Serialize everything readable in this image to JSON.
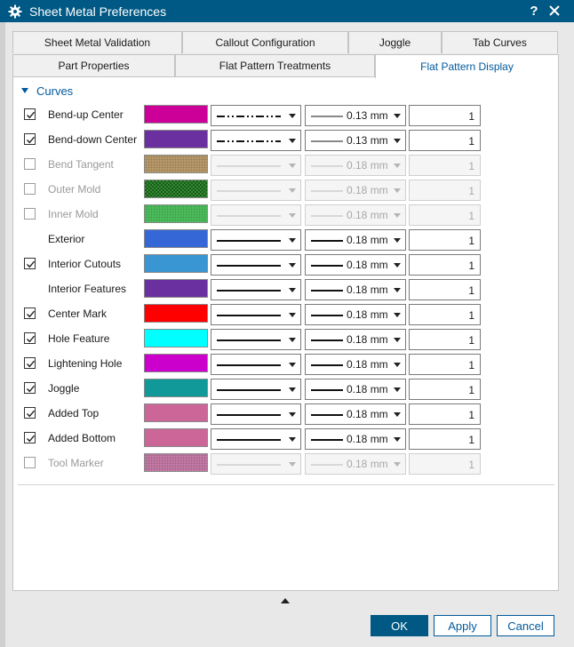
{
  "window": {
    "title": "Sheet Metal Preferences",
    "help_label": "?",
    "accent": "#005984"
  },
  "tabs_top": [
    {
      "label": "Sheet Metal Validation"
    },
    {
      "label": "Callout Configuration"
    },
    {
      "label": "Joggle"
    },
    {
      "label": "Tab Curves"
    }
  ],
  "tabs_bottom": [
    {
      "label": "Part Properties"
    },
    {
      "label": "Flat Pattern Treatments"
    },
    {
      "label": "Flat Pattern Display",
      "active": true
    }
  ],
  "group": {
    "label": "Curves"
  },
  "rows": [
    {
      "label": "Bend-up Center",
      "checkbox": true,
      "checked": true,
      "enabled": true,
      "color": "#cc0099",
      "pattern": "none",
      "line_type": "dash-dot-dot",
      "width": "0.13 mm",
      "weight": "thin",
      "value": "1"
    },
    {
      "label": "Bend-down Center",
      "checkbox": true,
      "checked": true,
      "enabled": true,
      "color": "#6a30a0",
      "pattern": "none",
      "line_type": "dash-dot-dot",
      "width": "0.13 mm",
      "weight": "thin",
      "value": "1"
    },
    {
      "label": "Bend Tangent",
      "checkbox": true,
      "checked": false,
      "enabled": false,
      "color": "#b89a6a",
      "pattern": "noise",
      "line_type": "solid",
      "width": "0.18 mm",
      "weight": "thick",
      "value": "1"
    },
    {
      "label": "Outer Mold",
      "checkbox": true,
      "checked": false,
      "enabled": false,
      "color": "#2e8b2e",
      "pattern": "checker",
      "line_type": "solid",
      "width": "0.18 mm",
      "weight": "thick",
      "value": "1"
    },
    {
      "label": "Inner Mold",
      "checkbox": true,
      "checked": false,
      "enabled": false,
      "color": "#4cbf5c",
      "pattern": "noise",
      "line_type": "solid",
      "width": "0.18 mm",
      "weight": "thick",
      "value": "1"
    },
    {
      "label": "Exterior",
      "checkbox": false,
      "checked": false,
      "enabled": true,
      "color": "#3567d6",
      "pattern": "none",
      "line_type": "solid",
      "width": "0.18 mm",
      "weight": "thick",
      "value": "1"
    },
    {
      "label": "Interior Cutouts",
      "checkbox": true,
      "checked": true,
      "enabled": true,
      "color": "#3a96d2",
      "pattern": "none",
      "line_type": "solid",
      "width": "0.18 mm",
      "weight": "thick",
      "value": "1"
    },
    {
      "label": "Interior Features",
      "checkbox": false,
      "checked": false,
      "enabled": true,
      "color": "#6a30a0",
      "pattern": "none",
      "line_type": "solid",
      "width": "0.18 mm",
      "weight": "thick",
      "value": "1"
    },
    {
      "label": "Center Mark",
      "checkbox": true,
      "checked": true,
      "enabled": true,
      "color": "#ff0000",
      "pattern": "none",
      "line_type": "solid",
      "width": "0.18 mm",
      "weight": "thick",
      "value": "1"
    },
    {
      "label": "Hole Feature",
      "checkbox": true,
      "checked": true,
      "enabled": true,
      "color": "#00ffff",
      "pattern": "none",
      "line_type": "solid",
      "width": "0.18 mm",
      "weight": "thick",
      "value": "1"
    },
    {
      "label": "Lightening Hole",
      "checkbox": true,
      "checked": true,
      "enabled": true,
      "color": "#cc00cc",
      "pattern": "none",
      "line_type": "solid",
      "width": "0.18 mm",
      "weight": "thick",
      "value": "1"
    },
    {
      "label": "Joggle",
      "checkbox": true,
      "checked": true,
      "enabled": true,
      "color": "#119999",
      "pattern": "none",
      "line_type": "solid",
      "width": "0.18 mm",
      "weight": "thick",
      "value": "1"
    },
    {
      "label": "Added Top",
      "checkbox": true,
      "checked": true,
      "enabled": true,
      "color": "#cc6699",
      "pattern": "none",
      "line_type": "solid",
      "width": "0.18 mm",
      "weight": "thick",
      "value": "1"
    },
    {
      "label": "Added Bottom",
      "checkbox": true,
      "checked": true,
      "enabled": true,
      "color": "#cc6699",
      "pattern": "none",
      "line_type": "solid",
      "width": "0.18 mm",
      "weight": "thick",
      "value": "1"
    },
    {
      "label": "Tool Marker",
      "checkbox": true,
      "checked": false,
      "enabled": false,
      "color": "#c47aa6",
      "pattern": "noise",
      "line_type": "solid",
      "width": "0.18 mm",
      "weight": "thick",
      "value": "1"
    }
  ],
  "buttons": {
    "ok": "OK",
    "apply": "Apply",
    "cancel": "Cancel"
  }
}
